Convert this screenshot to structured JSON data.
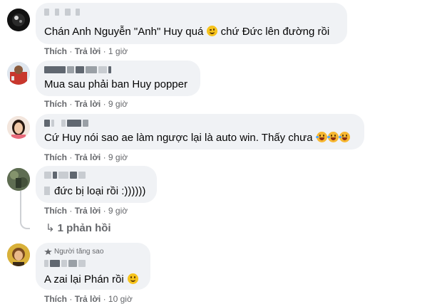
{
  "comments": [
    {
      "text": "Chán Anh Nguyễn \"Anh\" Huy quá",
      "text_after": "chứ Đức lên đường rồi",
      "emoji": "winking-face-emoji",
      "like": "Thích",
      "reply": "Trả lời",
      "time": "1 giờ"
    },
    {
      "text": "Mua sau phải ban Huy popper",
      "like": "Thích",
      "reply": "Trả lời",
      "time": "9 giờ"
    },
    {
      "text": "Cứ Huy nói sao ae làm ngược lại là auto win. Thấy chưa",
      "emoji": "rolling-on-floor-laughing-emoji x3",
      "like": "Thích",
      "reply": "Trả lời",
      "time": "9 giờ"
    },
    {
      "text": "đức bị loại rồi :))))))",
      "like": "Thích",
      "reply": "Trả lời",
      "time": "9 giờ",
      "replies_label": "1 phản hồi"
    },
    {
      "badge": "Người tăng sao",
      "text": "A zai lại Phán rồi",
      "emoji": "grinning-face-emoji",
      "like": "Thích",
      "reply": "Trả lời",
      "time": "10 giờ"
    }
  ],
  "separator": "·",
  "colors": {
    "bubble": "#f0f2f5",
    "meta": "#65676b",
    "text": "#050505",
    "thread": "#ced0d4"
  }
}
